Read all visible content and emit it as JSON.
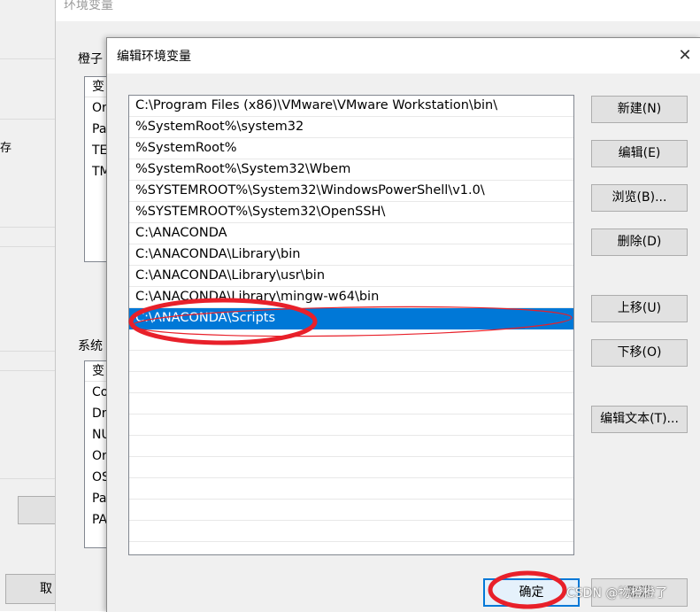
{
  "background_window": {
    "partial_text": "存",
    "partial_button_label": "取"
  },
  "env_window": {
    "title": "环境变量",
    "user_group_label": "橙子",
    "user_list": {
      "header": "变",
      "rows": [
        "Or",
        "Pa",
        "TE",
        "TM"
      ]
    },
    "system_group_label": "系统",
    "system_list": {
      "header": "变",
      "rows": [
        "Co",
        "Dr",
        "NU",
        "Or",
        "OS",
        "Pa",
        "PA"
      ]
    }
  },
  "dialog": {
    "title": "编辑环境变量",
    "close_glyph": "✕",
    "paths": [
      "C:\\Program Files (x86)\\VMware\\VMware Workstation\\bin\\",
      "%SystemRoot%\\system32",
      "%SystemRoot%",
      "%SystemRoot%\\System32\\Wbem",
      "%SYSTEMROOT%\\System32\\WindowsPowerShell\\v1.0\\",
      "%SYSTEMROOT%\\System32\\OpenSSH\\",
      "C:\\ANACONDA",
      "C:\\ANACONDA\\Library\\bin",
      "C:\\ANACONDA\\Library\\usr\\bin",
      "C:\\ANACONDA\\Library\\mingw-w64\\bin",
      "C:\\ANACONDA\\Scripts"
    ],
    "selected_path_index": 10,
    "buttons": {
      "new": "新建(N)",
      "edit": "编辑(E)",
      "browse": "浏览(B)...",
      "delete": "删除(D)",
      "move_up": "上移(U)",
      "move_down": "下移(O)",
      "edit_text": "编辑文本(T)...",
      "ok": "确定",
      "cancel": "取消"
    }
  },
  "colors": {
    "selection": "#0078d7",
    "annotation": "#e8202a"
  },
  "watermark": "CSDN @物橙橙了"
}
